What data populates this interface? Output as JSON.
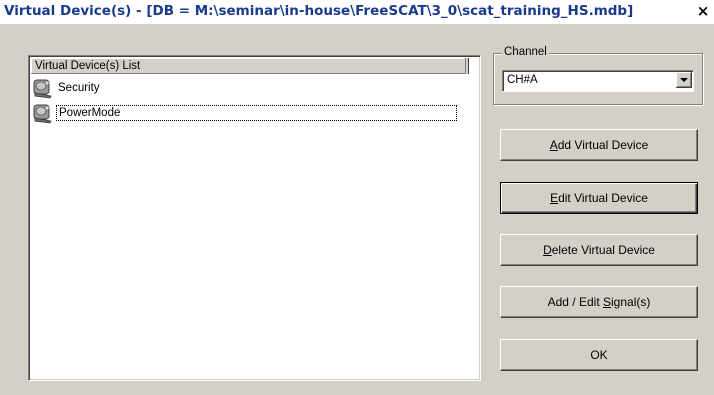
{
  "window": {
    "title": "Virtual Device(s) - [DB = M:\\seminar\\in-house\\FreeSCAT\\3_0\\scat_training_HS.mdb]",
    "close_symbol": "×",
    "close_icon": "close-icon"
  },
  "list": {
    "header": "Virtual Device(s) List",
    "items": [
      {
        "label": "Security",
        "icon": "virtual-device-icon",
        "selected": false
      },
      {
        "label": "PowerMode",
        "icon": "virtual-device-icon",
        "selected": true
      }
    ]
  },
  "channel": {
    "group_label": "Channel",
    "selected_value": "CH#A"
  },
  "buttons": {
    "add_virtual_device": {
      "mnemonic": "A",
      "rest": "dd Virtual Device"
    },
    "edit_virtual_device": {
      "mnemonic": "E",
      "rest": "dit Virtual Device"
    },
    "delete_virtual_device": {
      "mnemonic": "D",
      "rest": "elete Virtual Device"
    },
    "add_edit_signals": {
      "pre": "Add / Edit ",
      "mnemonic": "S",
      "rest": "ignal(s)"
    },
    "ok": "OK"
  },
  "colors": {
    "dialog_bg": "#d4d0c8",
    "title_text": "#1a3b8c"
  }
}
